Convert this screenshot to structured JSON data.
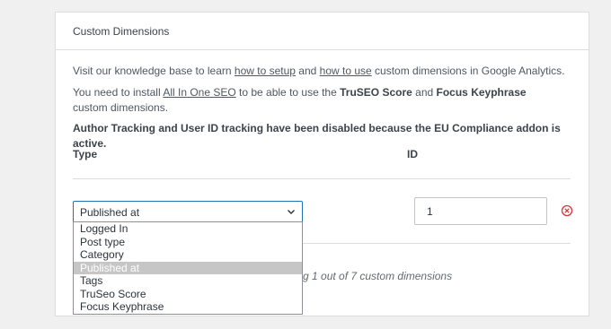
{
  "panel": {
    "title": "Custom Dimensions",
    "p1_before": "Visit our knowledge base to learn ",
    "p1_link1": "how to setup",
    "p1_mid": " and ",
    "p1_link2": "how to use",
    "p1_after": " custom dimensions in Google Analytics.",
    "p2_before": "You need to install ",
    "p2_link": "All In One SEO",
    "p2_mid1": " to be able to use the ",
    "p2_bold1": "TruSEO Score",
    "p2_mid2": " and ",
    "p2_bold2": "Focus Keyphrase",
    "p2_after": " custom dimensions.",
    "p3": "Author Tracking and User ID tracking have been disabled because the EU Compliance addon is active."
  },
  "table": {
    "type_header": "Type",
    "id_header": "ID"
  },
  "row": {
    "selected_type": "Published at",
    "id_value": "1",
    "remove_icon": "circle-x-icon"
  },
  "count_text": "g 1 out of 7 custom dimensions",
  "dropdown": {
    "options": [
      "Logged In",
      "Post type",
      "Category",
      "Published at",
      "Tags",
      "TruSeo Score",
      "Focus Keyphrase"
    ],
    "selected_index": 3
  },
  "colors": {
    "accent": "#2271b1",
    "remove": "#d63638",
    "selected_option_bg": "#c6c6c6"
  }
}
